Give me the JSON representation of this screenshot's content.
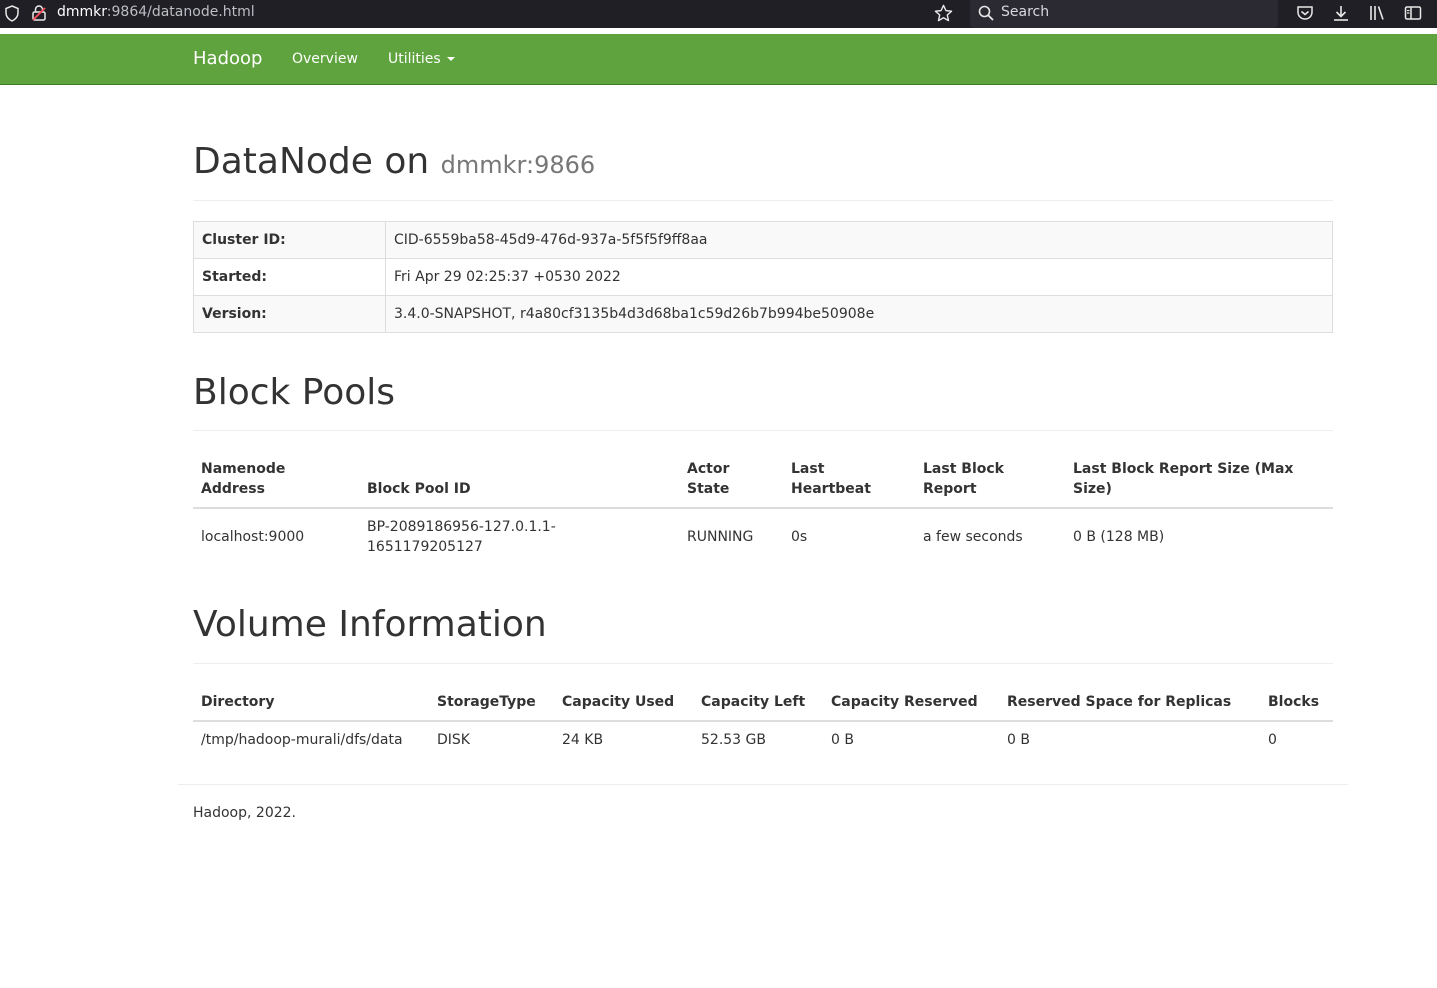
{
  "browser": {
    "url_host": "dmmkr",
    "url_rest": ":9864/datanode.html",
    "search_placeholder": "Search"
  },
  "navbar": {
    "brand": "Hadoop",
    "links": [
      "Overview",
      "Utilities"
    ]
  },
  "header": {
    "title": "DataNode on",
    "subtitle": "dmmkr:9866"
  },
  "info": [
    {
      "key": "Cluster ID:",
      "value": "CID-6559ba58-45d9-476d-937a-5f5f5f9ff8aa"
    },
    {
      "key": "Started:",
      "value": "Fri Apr 29 02:25:37 +0530 2022"
    },
    {
      "key": "Version:",
      "value": "3.4.0-SNAPSHOT, r4a80cf3135b4d3d68ba1c59d26b7b994be50908e"
    }
  ],
  "block_pools": {
    "title": "Block Pools",
    "columns": [
      "Namenode Address",
      "Block Pool ID",
      "Actor State",
      "Last Heartbeat",
      "Last Block Report",
      "Last Block Report Size (Max Size)"
    ],
    "rows": [
      [
        "localhost:9000",
        "BP-2089186956-127.0.1.1-1651179205127",
        "RUNNING",
        "0s",
        "a few seconds",
        "0 B (128 MB)"
      ]
    ]
  },
  "volumes": {
    "title": "Volume Information",
    "columns": [
      "Directory",
      "StorageType",
      "Capacity Used",
      "Capacity Left",
      "Capacity Reserved",
      "Reserved Space for Replicas",
      "Blocks"
    ],
    "rows": [
      [
        "/tmp/hadoop-murali/dfs/data",
        "DISK",
        "24 KB",
        "52.53 GB",
        "0 B",
        "0 B",
        "0"
      ]
    ]
  },
  "footer": {
    "text": "Hadoop, 2022."
  },
  "colors": {
    "navbar": "#5fa33e",
    "chrome": "#1f1f25"
  }
}
